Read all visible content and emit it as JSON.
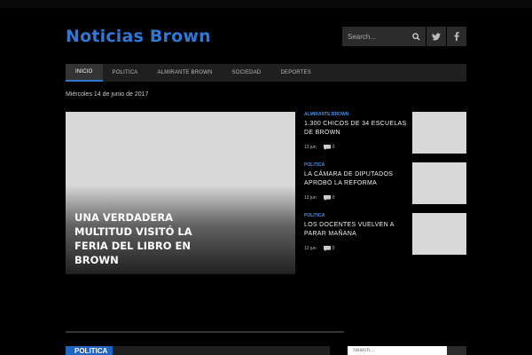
{
  "site": {
    "title": "Noticias Brown"
  },
  "header": {
    "search_placeholder": "Search...",
    "social": [
      "twitter-icon",
      "facebook-icon"
    ]
  },
  "nav": {
    "items": [
      {
        "label": "INICIO",
        "active": true
      },
      {
        "label": "POLITICA",
        "active": false
      },
      {
        "label": "ALMIRANTE BROWN",
        "active": false
      },
      {
        "label": "SOCIEDAD",
        "active": false
      },
      {
        "label": "DEPORTES",
        "active": false
      }
    ]
  },
  "date": "Miércoles 14 de junio de 2017",
  "featured": {
    "title": "Una verdadera multitud visitó la feria del libro en Brown"
  },
  "side_posts": [
    {
      "category": "ALMIRANTE BROWN",
      "title": "1.300 CHICOS DE 34 ESCUELAS DE BROWN",
      "date": "13 jun",
      "comments": "0"
    },
    {
      "category": "POLITICA",
      "title": "LA CÁMARA DE DIPUTADOS APROBÓ LA REFORMA",
      "date": "13 jun",
      "comments": "0"
    },
    {
      "category": "POLITICA",
      "title": "LOS DOCENTES VUELVEN A PARAR MAÑANA",
      "date": "13 jun",
      "comments": "0"
    }
  ],
  "sections": {
    "politica_label": "POLITICA",
    "sidebar_search_placeholder": "Search..."
  },
  "colors": {
    "accent": "#2f78d6",
    "section": "#1e65c3",
    "background": "#000000"
  }
}
